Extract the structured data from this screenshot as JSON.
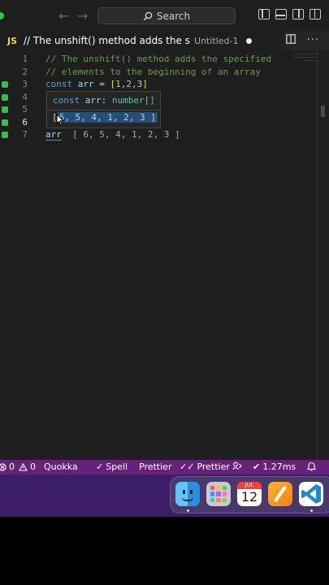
{
  "titlebar": {
    "search_label": "Search",
    "back": "←",
    "forward": "→"
  },
  "tab": {
    "lang": "JS",
    "title": "// The unshift() method adds the specifi",
    "subtitle": "Untitled-1"
  },
  "editor": {
    "lines": [
      {
        "n": "1",
        "comment": "// The unshift() method adds the specified"
      },
      {
        "n": "2",
        "comment": "// elements to the beginning of an array"
      },
      {
        "n": "3",
        "kw": "const",
        "var": "arr",
        "eq": " = ",
        "open": "[",
        "nums": "1,2,3",
        "close": "]"
      },
      {
        "n": "4"
      },
      {
        "n": "5"
      },
      {
        "n": "6"
      },
      {
        "n": "7",
        "word": "arr",
        "value": "[ 6, 5, 4, 1, 2, 3 ]"
      }
    ],
    "hover": {
      "kw": "const",
      "name": "arr",
      "colon": ": ",
      "type": "number[]",
      "bracket": "[",
      "value": "6, 5, 4, 1, 2, 3 ]"
    }
  },
  "statusbar": {
    "errors": "0",
    "warnings": "0",
    "quokka": "Quokka",
    "spell": "Spell",
    "prettier1": "Prettier",
    "prettier2": "Prettier",
    "timing": "1.27ms"
  },
  "dock": {
    "calendar_month": "JUL",
    "calendar_day": "12"
  },
  "colors": {
    "status_bg": "#68217a",
    "editor_bg": "#1e1e1e",
    "gutter_added": "#3fb950"
  }
}
